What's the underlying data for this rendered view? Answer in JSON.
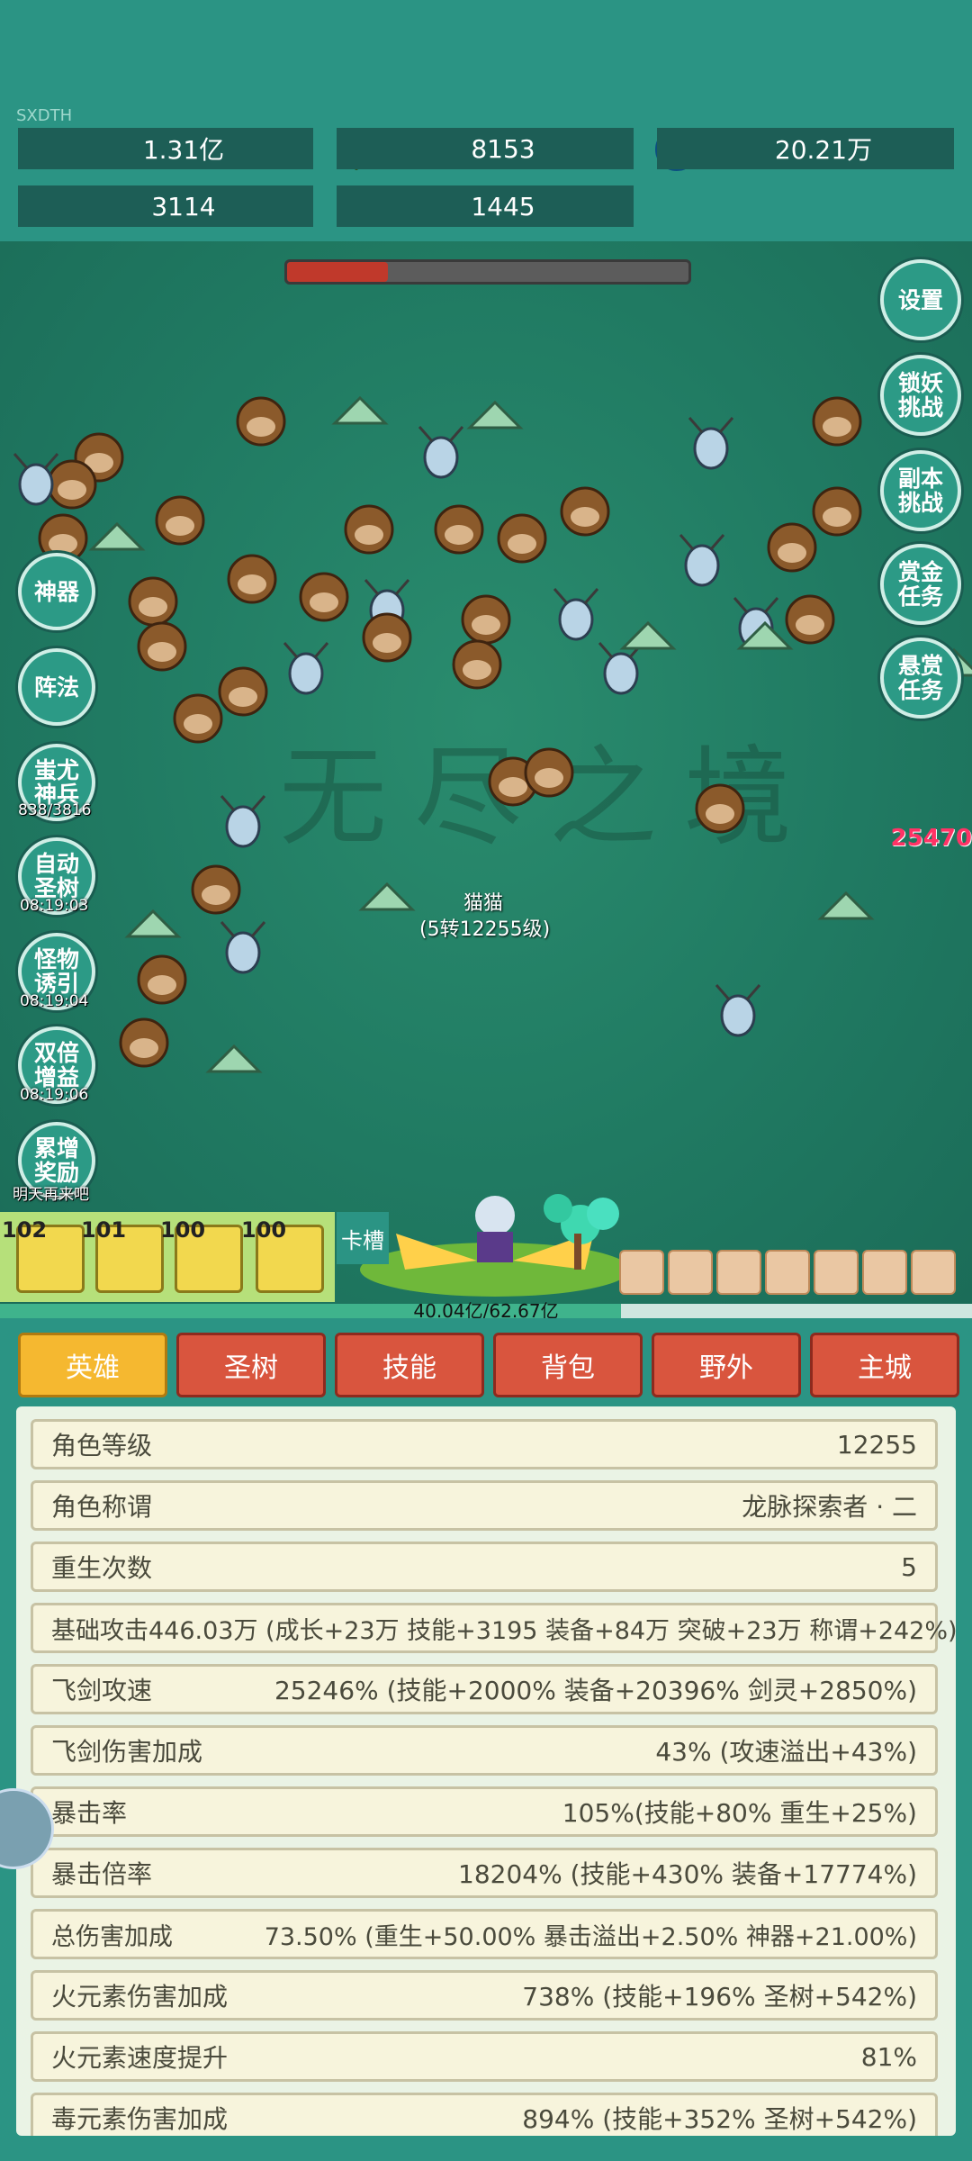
{
  "watermark": "SXDTH",
  "resources": [
    {
      "icon": "purple-gem-icon",
      "value": "1.31亿"
    },
    {
      "icon": "green-gem-icon",
      "value": "8153"
    },
    {
      "icon": "blue-orb-icon",
      "value": "20.21万"
    },
    {
      "icon": "blue-book-icon",
      "value": "3114"
    },
    {
      "icon": "blue-crystal-icon",
      "value": "1445"
    }
  ],
  "boss_hp": 0.25,
  "game_watermark": "无尽之境",
  "right_buttons": [
    "设置",
    "锁妖\n挑战",
    "副本\n挑战",
    "赏金\n任务",
    "悬赏\n任务"
  ],
  "left_buttons": [
    {
      "label": "神器",
      "sub": ""
    },
    {
      "label": "阵法",
      "sub": ""
    },
    {
      "label": "蚩尤\n神兵",
      "sub": "838/3816"
    },
    {
      "label": "自动\n圣树",
      "sub": "08:19:03"
    },
    {
      "label": "怪物\n诱引",
      "sub": "08:19:04"
    },
    {
      "label": "双倍\n增益",
      "sub": "08:19:06"
    },
    {
      "label": "累增\n奖励",
      "sub": "明天再来吧"
    }
  ],
  "damage_number": "25470",
  "hero": {
    "name": "猫猫",
    "level": "(5转12255级)"
  },
  "equip_slots": [
    {
      "level": "102",
      "icon": "sword-icon"
    },
    {
      "level": "101",
      "icon": "helmet-icon"
    },
    {
      "level": "100",
      "icon": "armor-icon"
    },
    {
      "level": "100",
      "icon": "boots-icon"
    }
  ],
  "kacao_label": "卡槽",
  "exp": {
    "text": "40.04亿/62.67亿",
    "fraction": 0.639
  },
  "tabs": [
    "英雄",
    "圣树",
    "技能",
    "背包",
    "野外",
    "主城"
  ],
  "active_tab": 0,
  "stats": [
    {
      "k": "角色等级",
      "v": "12255"
    },
    {
      "k": "角色称谓",
      "v": "龙脉探索者 · 二"
    },
    {
      "k": "重生次数",
      "v": "5"
    },
    {
      "k": "基础攻击446.03万 (成长+23万 技能+3195 装备+84万 突破+23万 称谓+242%)",
      "v": ""
    },
    {
      "k": "飞剑攻速",
      "v": "25246% (技能+2000% 装备+20396% 剑灵+2850%)"
    },
    {
      "k": "飞剑伤害加成",
      "v": "43% (攻速溢出+43%)"
    },
    {
      "k": "暴击率",
      "v": "105%(技能+80% 重生+25%)"
    },
    {
      "k": "暴击倍率",
      "v": "18204% (技能+430% 装备+17774%)"
    },
    {
      "k": "总伤害加成",
      "v": "73.50% (重生+50.00% 暴击溢出+2.50% 神器+21.00%)"
    },
    {
      "k": "火元素伤害加成",
      "v": "738% (技能+196% 圣树+542%)"
    },
    {
      "k": "火元素速度提升",
      "v": "81%"
    },
    {
      "k": "毒元素伤害加成",
      "v": "894% (技能+352% 圣树+542%)"
    }
  ]
}
